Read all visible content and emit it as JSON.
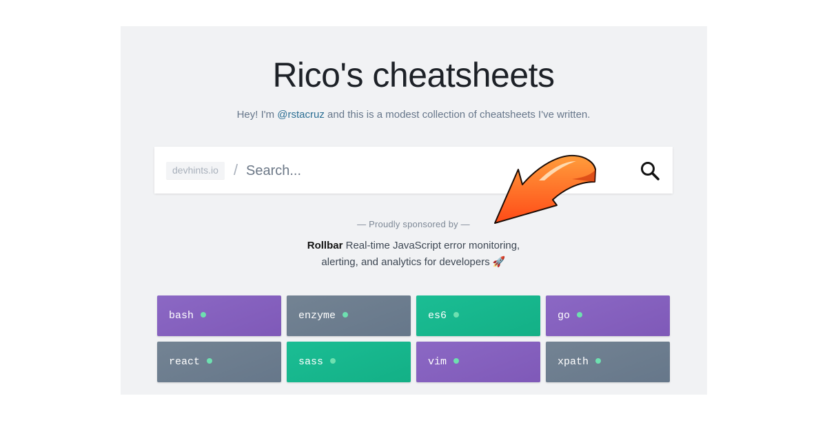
{
  "header": {
    "title": "Rico's cheatsheets",
    "subtitle_before": "Hey! I'm ",
    "subtitle_link": "@rstacruz",
    "subtitle_after": " and this is a modest collection of cheatsheets I've written."
  },
  "search": {
    "domain": "devhints.io",
    "slash": "/",
    "placeholder": "Search...",
    "icon": "search-icon"
  },
  "sponsor": {
    "label": "— Proudly sponsored by —",
    "name": "Rollbar",
    "description": " Real-time JavaScript error monitoring, alerting, and analytics for developers 🚀"
  },
  "annotation": {
    "icon": "orange-arrow-icon",
    "color": "#ff5a1f"
  },
  "colors": {
    "purple": "#8660c0",
    "slate": "#6c7c8e",
    "green": "#16b78c",
    "dot": "#6ee0b0"
  },
  "sheets": [
    {
      "label": "bash",
      "color": "purple"
    },
    {
      "label": "enzyme",
      "color": "slate"
    },
    {
      "label": "es6",
      "color": "green"
    },
    {
      "label": "go",
      "color": "purple"
    },
    {
      "label": "react",
      "color": "slate"
    },
    {
      "label": "sass",
      "color": "green"
    },
    {
      "label": "vim",
      "color": "purple"
    },
    {
      "label": "xpath",
      "color": "slate"
    }
  ]
}
